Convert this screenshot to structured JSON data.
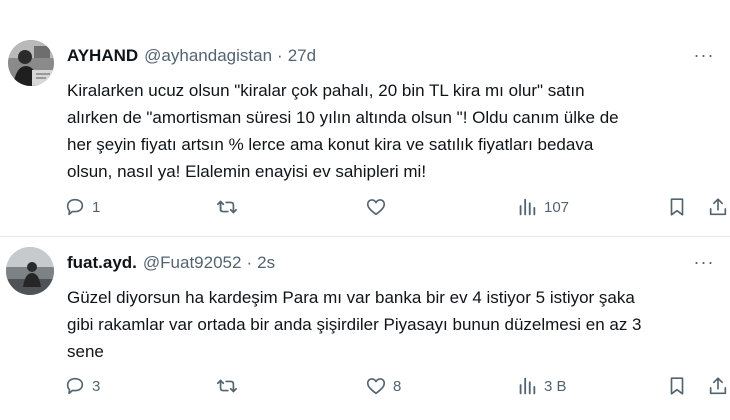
{
  "tweets": [
    {
      "avatar": "avatar-photo-man-at-desk",
      "display_name": "AYHAND",
      "handle": "@ayhandagistan",
      "separator": "·",
      "timestamp": "27d",
      "more": "···",
      "text": "Kiralarken ucuz olsun \"kiralar çok pahalı, 20 bin TL kira mı olur\"  satın\nalırken de \"amortisman süresi 10 yılın altında olsun \"! Oldu canım ülke de\nher şeyin fiyatı artsın % lerce ama konut kira ve satılık fiyatları bedava\nolsun, nasıl ya! Elalemin enayisi ev sahipleri mi!",
      "actions": {
        "reply": {
          "icon": "reply-icon",
          "count": "1"
        },
        "retweet": {
          "icon": "retweet-icon",
          "count": ""
        },
        "like": {
          "icon": "heart-icon",
          "count": ""
        },
        "views": {
          "icon": "views-icon",
          "count": "107"
        },
        "bookmark": {
          "icon": "bookmark-icon"
        },
        "share": {
          "icon": "share-icon"
        }
      }
    },
    {
      "avatar": "avatar-photo-person-by-sea",
      "display_name": "fuat.ayd.",
      "handle": "@Fuat92052",
      "separator": "·",
      "timestamp": "2s",
      "more": "···",
      "text": "Güzel diyorsun ha kardeşim Para mı var banka bir ev 4 istiyor 5 istiyor şaka\ngibi rakamlar var ortada bir anda şişirdiler Piyasayı bunun düzelmesi en az 3\nsene",
      "actions": {
        "reply": {
          "icon": "reply-icon",
          "count": "3"
        },
        "retweet": {
          "icon": "retweet-icon",
          "count": ""
        },
        "like": {
          "icon": "heart-icon",
          "count": "8"
        },
        "views": {
          "icon": "views-icon",
          "count": "3 B"
        },
        "bookmark": {
          "icon": "bookmark-icon"
        },
        "share": {
          "icon": "share-icon"
        }
      }
    }
  ],
  "colors": {
    "primary_text": "#0f1419",
    "secondary_text": "#536471",
    "divider": "#e6e9ec",
    "background": "#ffffff"
  }
}
